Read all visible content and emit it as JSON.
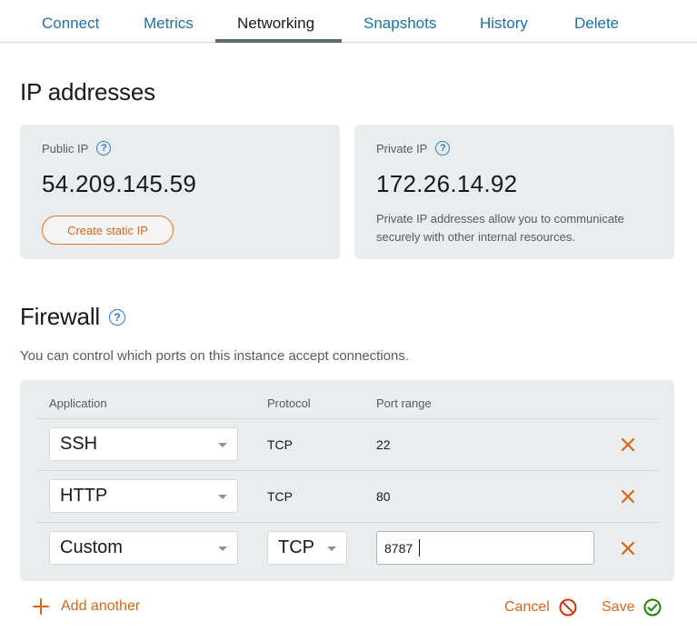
{
  "tabs": [
    {
      "label": "Connect"
    },
    {
      "label": "Metrics"
    },
    {
      "label": "Networking",
      "active": true
    },
    {
      "label": "Snapshots"
    },
    {
      "label": "History"
    },
    {
      "label": "Delete"
    }
  ],
  "ip_section": {
    "title": "IP addresses",
    "public": {
      "label": "Public IP",
      "value": "54.209.145.59",
      "button_label": "Create static IP"
    },
    "private": {
      "label": "Private IP",
      "value": "172.26.14.92",
      "description": "Private IP addresses allow you to communicate securely with other internal resources."
    }
  },
  "firewall": {
    "title": "Firewall",
    "description": "You can control which ports on this instance accept connections.",
    "columns": {
      "application": "Application",
      "protocol": "Protocol",
      "port_range": "Port range"
    },
    "rules": [
      {
        "application": "SSH",
        "protocol": "TCP",
        "port_range": "22"
      },
      {
        "application": "HTTP",
        "protocol": "TCP",
        "port_range": "80"
      },
      {
        "application": "Custom",
        "protocol": "TCP",
        "port_range": "8787"
      }
    ],
    "add_label": "Add another",
    "cancel_label": "Cancel",
    "save_label": "Save"
  },
  "colors": {
    "accent_orange": "#d4661b",
    "link_blue": "#1f6fa8",
    "help_blue": "#2b7bd0",
    "cancel_red": "#d13212",
    "save_green": "#1d8102",
    "panel_grey": "#eaeded"
  },
  "icons": {
    "help": "question-circle-icon",
    "remove": "close-x-icon",
    "add": "plus-icon",
    "cancel": "prohibited-icon",
    "save": "check-circle-icon",
    "dropdown": "caret-down-icon"
  }
}
